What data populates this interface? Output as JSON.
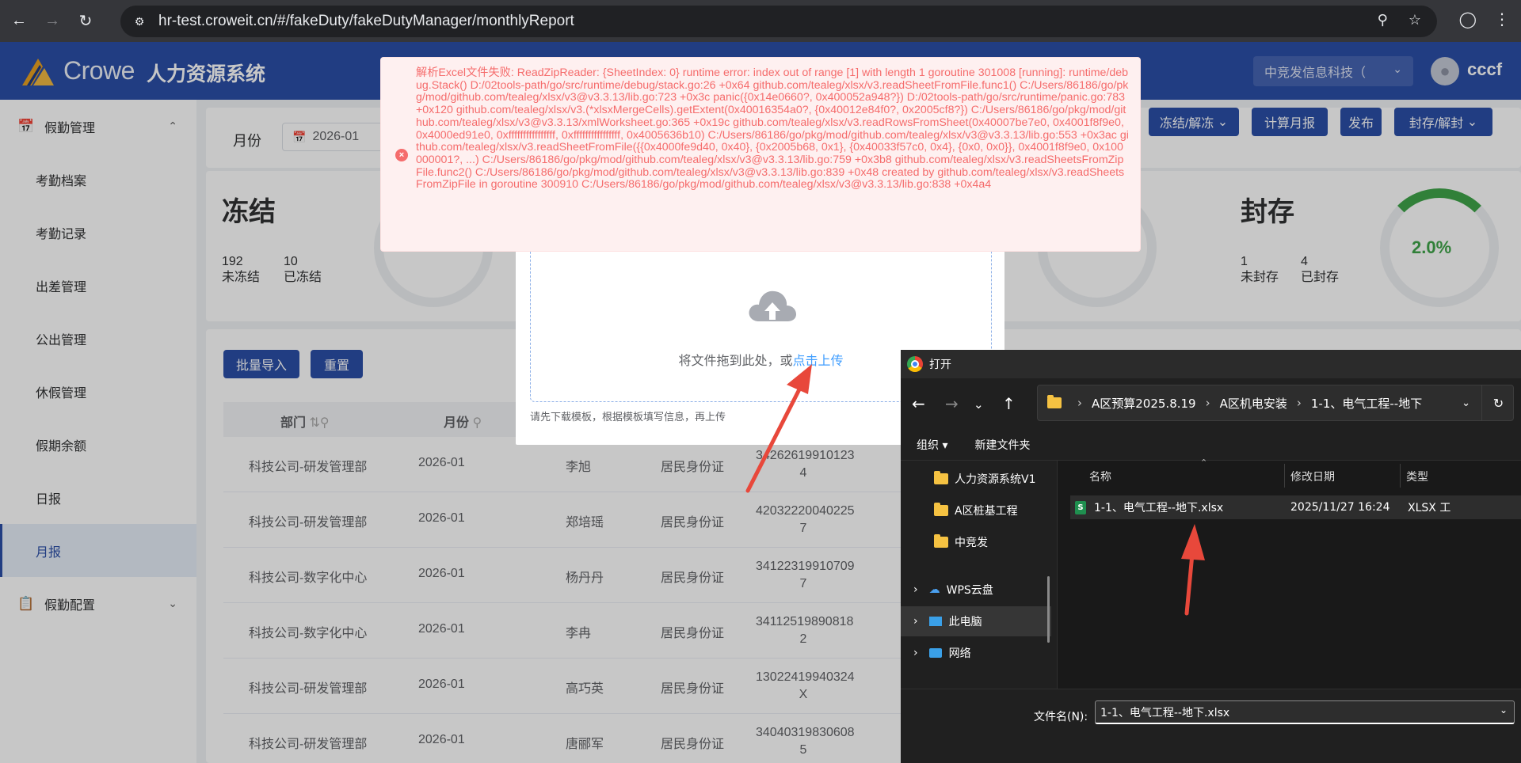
{
  "browser": {
    "url": "hr-test.croweit.cn/#/fakeDuty/fakeDutyManager/monthlyReport"
  },
  "header": {
    "logo_word": "Crowe",
    "system_name": "人力资源系统",
    "company": "中竞发信息科技（",
    "username": "cccf"
  },
  "sidebar": {
    "group1": "假勤管理",
    "items": [
      "考勤档案",
      "考勤记录",
      "出差管理",
      "公出管理",
      "休假管理",
      "假期余额",
      "日报",
      "月报"
    ],
    "group2": "假勤配置"
  },
  "filter": {
    "month_label": "月份",
    "month_value": "2026-01",
    "btn_freeze": "冻结/解冻",
    "btn_calc": "计算月报",
    "btn_publish": "发布",
    "btn_seal": "封存/解封"
  },
  "stats": {
    "freeze_title": "冻结",
    "unfrozen_count": "192",
    "unfrozen_label": "未冻结",
    "frozen_count": "10",
    "frozen_label": "已冻结",
    "seal_title": "封存",
    "unsealed_count": "1",
    "unsealed_label": "未封存",
    "sealed_count": "4",
    "sealed_label": "已封存",
    "seal_percent": "2.0%"
  },
  "table": {
    "btn_import": "批量导入",
    "btn_reset": "重置",
    "headers": [
      "部门",
      "月份"
    ],
    "rows": [
      {
        "dept": "科技公司-研发管理部",
        "month": "2026-01",
        "name": "李旭",
        "id_type": "居民身份证",
        "id_a": "34262619910123",
        "id_b": "4"
      },
      {
        "dept": "科技公司-研发管理部",
        "month": "2026-01",
        "name": "郑培瑶",
        "id_type": "居民身份证",
        "id_a": "42032220040225",
        "id_b": "7"
      },
      {
        "dept": "科技公司-数字化中心",
        "month": "2026-01",
        "name": "杨丹丹",
        "id_type": "居民身份证",
        "id_a": "34122319910709",
        "id_b": "7"
      },
      {
        "dept": "科技公司-数字化中心",
        "month": "2026-01",
        "name": "李冉",
        "id_type": "居民身份证",
        "id_a": "34112519890818",
        "id_b": "2"
      },
      {
        "dept": "科技公司-研发管理部",
        "month": "2026-01",
        "name": "高巧英",
        "id_type": "居民身份证",
        "id_a": "13022419940324",
        "id_b": "X"
      },
      {
        "dept": "科技公司-研发管理部",
        "month": "2026-01",
        "name": "唐郦军",
        "id_type": "居民身份证",
        "id_a": "34040319830608",
        "id_b": "5"
      }
    ]
  },
  "upload": {
    "drop_text": "将文件拖到此处，或",
    "drop_link": "点击上传",
    "tip": "请先下载模板，根据模板填写信息，再上传"
  },
  "error": {
    "message": "解析Excel文件失败: ReadZipReader: {SheetIndex: 0} runtime error: index out of range [1] with length 1 goroutine 301008 [running]: runtime/debug.Stack() D:/02tools-path/go/src/runtime/debug/stack.go:26 +0x64 github.com/tealeg/xlsx/v3.readSheetFromFile.func1() C:/Users/86186/go/pkg/mod/github.com/tealeg/xlsx/v3@v3.3.13/lib.go:723 +0x3c panic({0x14e0660?, 0x400052a948?}) D:/02tools-path/go/src/runtime/panic.go:783 +0x120 github.com/tealeg/xlsx/v3.(*xlsxMergeCells).getExtent(0x40016354a0?, {0x40012e84f0?, 0x2005cf8?}) C:/Users/86186/go/pkg/mod/github.com/tealeg/xlsx/v3@v3.3.13/xmlWorksheet.go:365 +0x19c github.com/tealeg/xlsx/v3.readRowsFromSheet(0x40007be7e0, 0x4001f8f9e0, 0x4000ed91e0, 0xffffffffffffffff, 0xffffffffffffffff, 0x4005636b10) C:/Users/86186/go/pkg/mod/github.com/tealeg/xlsx/v3@v3.3.13/lib.go:553 +0x3ac github.com/tealeg/xlsx/v3.readSheetFromFile({{0x4000fe9d40, 0x40}, {0x2005b68, 0x1}, {0x40033f57c0, 0x4}, {0x0, 0x0}}, 0x4001f8f9e0, 0x100000001?, ...) C:/Users/86186/go/pkg/mod/github.com/tealeg/xlsx/v3@v3.3.13/lib.go:759 +0x3b8 github.com/tealeg/xlsx/v3.readSheetsFromZipFile.func2() C:/Users/86186/go/pkg/mod/github.com/tealeg/xlsx/v3@v3.3.13/lib.go:839 +0x48 created by github.com/tealeg/xlsx/v3.readSheetsFromZipFile in goroutine 300910 C:/Users/86186/go/pkg/mod/github.com/tealeg/xlsx/v3@v3.3.13/lib.go:838 +0x4a4"
  },
  "file_dialog": {
    "title": "打开",
    "path": [
      "A区预算2025.8.19",
      "A区机电安装",
      "1-1、电气工程--地下"
    ],
    "organize": "组织",
    "new_folder": "新建文件夹",
    "tree": [
      "人力资源系统V1",
      "A区桩基工程",
      "中竞发",
      "WPS云盘",
      "此电脑",
      "网络"
    ],
    "columns": [
      "名称",
      "修改日期",
      "类型"
    ],
    "file": {
      "name": "1-1、电气工程--地下.xlsx",
      "date": "2025/11/27 16:24",
      "type": "XLSX 工"
    },
    "filename_label": "文件名(N):",
    "filename_value": "1-1、电气工程--地下.xlsx"
  },
  "colors": {
    "brand": "#2b4fa7",
    "error": "#f56c6c",
    "annotation": "#e8483b"
  }
}
